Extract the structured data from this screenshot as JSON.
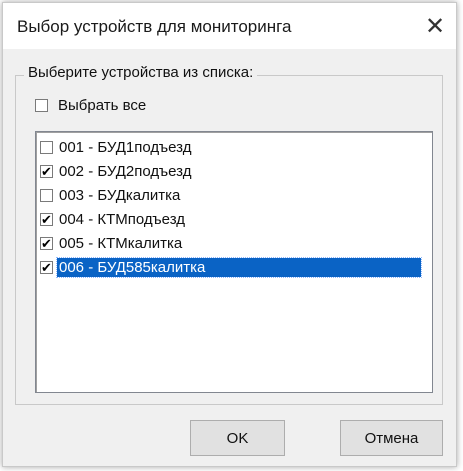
{
  "dialog": {
    "title": "Выбор устройств для мониторинга",
    "close_icon": "close-icon"
  },
  "group": {
    "legend": "Выберите устройства из списка:",
    "select_all_label": "Выбрать все",
    "select_all_checked": false
  },
  "devices": [
    {
      "label": "001 - БУД1подъезд",
      "checked": false,
      "selected": false
    },
    {
      "label": "002 - БУД2подъезд",
      "checked": true,
      "selected": false
    },
    {
      "label": "003 - БУДкалитка",
      "checked": false,
      "selected": false
    },
    {
      "label": "004 - КТМподъезд",
      "checked": true,
      "selected": false
    },
    {
      "label": "005 - КТМкалитка",
      "checked": true,
      "selected": false
    },
    {
      "label": "006 - БУД585калитка",
      "checked": true,
      "selected": true
    }
  ],
  "buttons": {
    "ok_label": "OK",
    "cancel_label": "Отмена"
  },
  "colors": {
    "selection": "#0a63c5",
    "dialog_bg": "#f0f0f0"
  }
}
